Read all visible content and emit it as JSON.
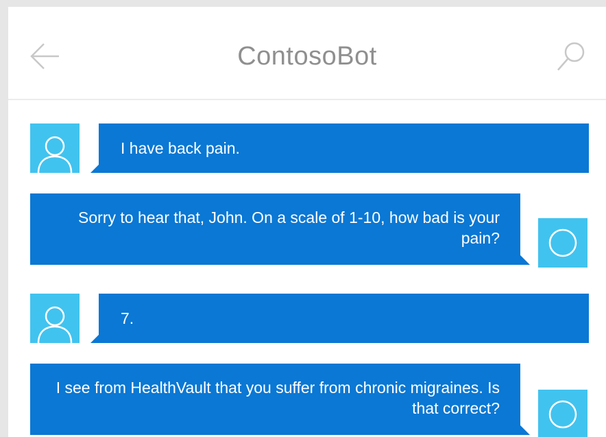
{
  "app": {
    "title": "ContosoBot",
    "back_icon": "arrow-left-icon",
    "search_icon": "search-icon"
  },
  "colors": {
    "header_text": "#8f8f8f",
    "bubble": "#0a78d4",
    "avatar": "#41c3ef",
    "background": "#ffffff"
  },
  "messages": [
    {
      "sender": "user",
      "avatar_icon": "user-avatar-icon",
      "text": "I have back pain."
    },
    {
      "sender": "bot",
      "avatar_icon": "bot-avatar-icon",
      "text": "Sorry to hear that, John. On a scale of 1-10, how bad is your pain?"
    },
    {
      "sender": "user",
      "avatar_icon": "user-avatar-icon",
      "text": "7."
    },
    {
      "sender": "bot",
      "avatar_icon": "bot-avatar-icon",
      "text": "I see from HealthVault that you suffer from chronic migraines. Is that correct?"
    }
  ]
}
